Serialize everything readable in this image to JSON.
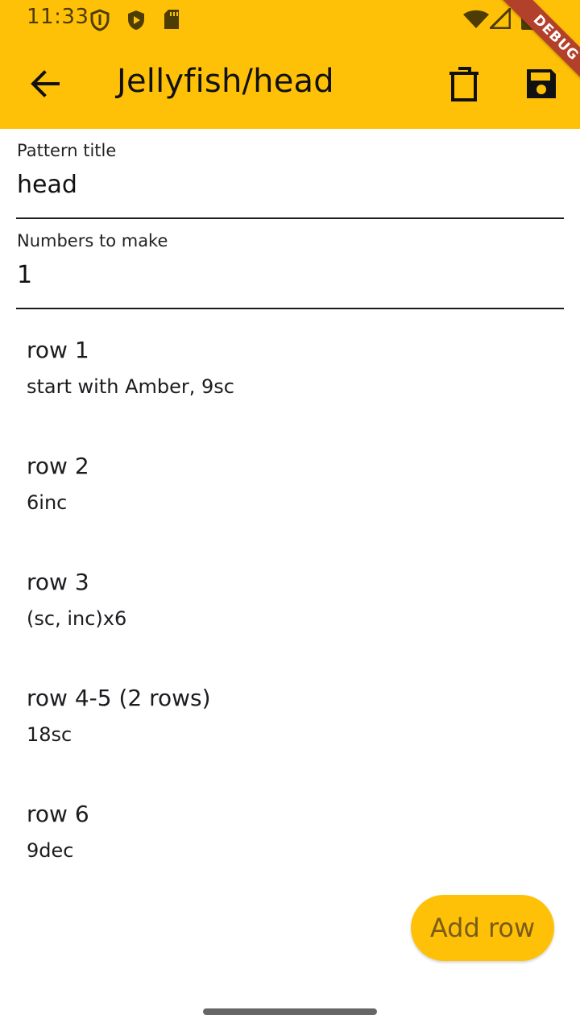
{
  "status_bar": {
    "time": "11:33",
    "icons": [
      "shield-outline-icon",
      "play-shield-icon",
      "sd-card-icon",
      "wifi-icon",
      "cell-signal-icon",
      "battery-icon"
    ]
  },
  "app_bar": {
    "title": "Jellyfish/head",
    "color": "#ffc107",
    "actions": [
      "back-arrow-icon",
      "delete-icon",
      "save-icon"
    ],
    "debug_label": "DEBUG"
  },
  "form": {
    "pattern_title": {
      "label": "Pattern title",
      "value": "head"
    },
    "numbers_to_make": {
      "label": "Numbers to make",
      "value": "1"
    }
  },
  "rows": [
    {
      "title": "row 1",
      "instructions": "start with Amber, 9sc"
    },
    {
      "title": "row 2",
      "instructions": "6inc"
    },
    {
      "title": "row 3",
      "instructions": "(sc, inc)x6"
    },
    {
      "title": "row 4-5 (2 rows)",
      "instructions": "18sc"
    },
    {
      "title": "row 6",
      "instructions": "9dec"
    }
  ],
  "add_row_button": {
    "label": "Add row"
  }
}
